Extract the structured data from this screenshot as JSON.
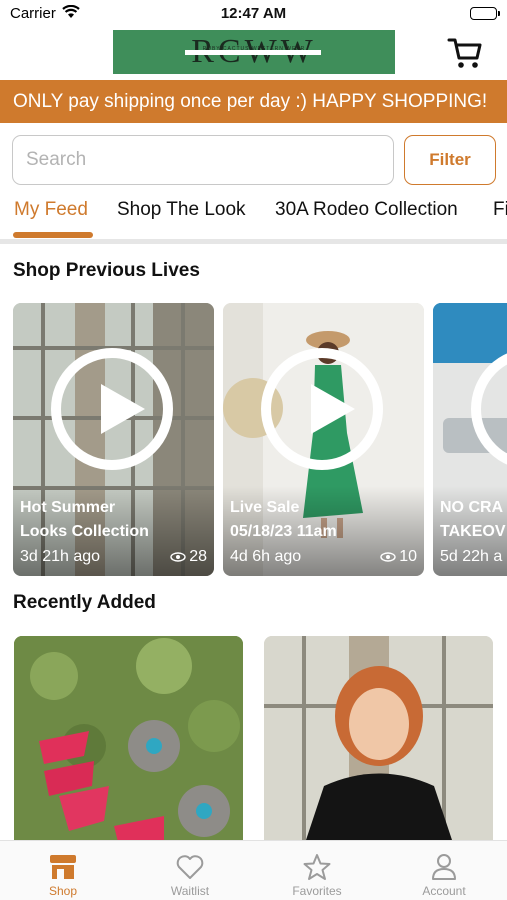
{
  "status_bar": {
    "carrier": "Carrier",
    "time": "12:47 AM"
  },
  "header": {
    "logo": {
      "text": "RCWW",
      "tagline": "RUBY CACTUS WESTERN WEAR"
    },
    "cart_icon": "shopping-cart-icon"
  },
  "banner": {
    "text": "ONLY pay shipping once per day :) HAPPY SHOPPING!"
  },
  "search": {
    "placeholder": "Search",
    "value": "",
    "filter_label": "Filter"
  },
  "tabs": [
    {
      "label": "My Feed",
      "active": true
    },
    {
      "label": "Shop The Look",
      "active": false
    },
    {
      "label": "30A Rodeo Collection",
      "active": false
    },
    {
      "label": "Fi",
      "active": false
    }
  ],
  "previous_lives": {
    "title": "Shop Previous Lives",
    "items": [
      {
        "title_line1": "Hot Summer",
        "title_line2": "Looks Collection",
        "ago": "3d 21h ago",
        "views": "28"
      },
      {
        "title_line1": "Live Sale",
        "title_line2": "05/18/23 11am",
        "ago": "4d 6h ago",
        "views": "10"
      },
      {
        "title_line1": "NO CRA",
        "title_line2": "TAKEOV",
        "ago": "5d 22h a",
        "views": ""
      }
    ]
  },
  "recently_added": {
    "title": "Recently Added"
  },
  "tab_bar": [
    {
      "label": "Shop",
      "icon": "storefront-icon",
      "active": true
    },
    {
      "label": "Waitlist",
      "icon": "heart-icon",
      "active": false
    },
    {
      "label": "Favorites",
      "icon": "star-icon",
      "active": false
    },
    {
      "label": "Account",
      "icon": "person-icon",
      "active": false
    }
  ],
  "colors": {
    "accent": "#cf7a2d",
    "logo_green": "#3f8e5a",
    "inactive": "#9b9b9b"
  }
}
